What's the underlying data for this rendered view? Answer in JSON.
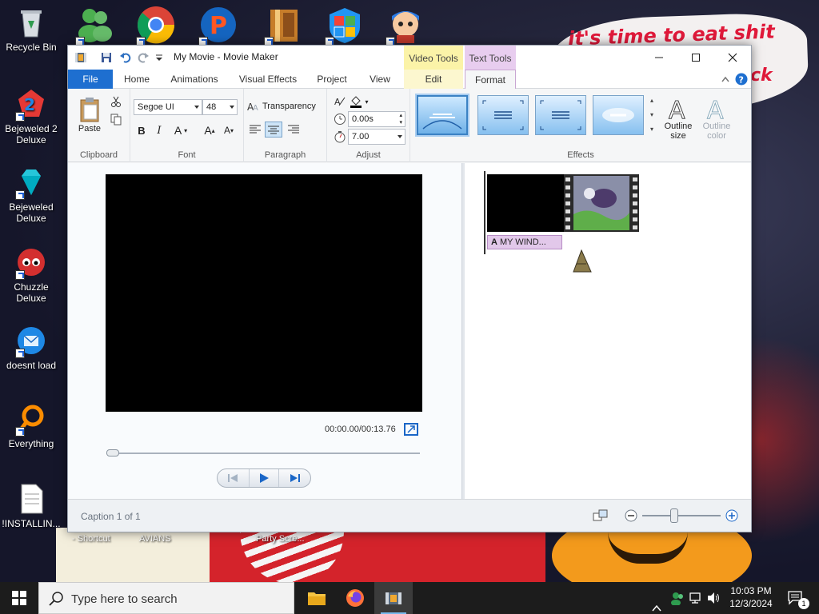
{
  "desktop": {
    "note_text": "it's time to eat shit",
    "note_text2": "ck",
    "icons": [
      {
        "label": "Recycle Bin"
      },
      {
        "label": "Bejeweled 2 Deluxe"
      },
      {
        "label": "Bejeweled Deluxe"
      },
      {
        "label": "Chuzzle Deluxe"
      },
      {
        "label": "doesnt load"
      },
      {
        "label": "Everything"
      },
      {
        "label": "!INSTALLIN..."
      }
    ],
    "bottom_labels": [
      "- Shortcut",
      "AVIANS",
      "Party Scre..."
    ]
  },
  "window": {
    "title": "My Movie - Movie Maker",
    "context_video": "Video Tools",
    "context_text": "Text Tools",
    "tabs": {
      "file": "File",
      "home": "Home",
      "animations": "Animations",
      "visual_effects": "Visual Effects",
      "project": "Project",
      "view": "View",
      "edit": "Edit",
      "format": "Format"
    },
    "ribbon": {
      "clipboard": {
        "label": "Clipboard",
        "paste": "Paste"
      },
      "font": {
        "label": "Font",
        "family": "Segoe UI",
        "size": "48",
        "bold": "B",
        "italic": "I",
        "color": "A",
        "grow": "A",
        "shrink": "A"
      },
      "paragraph": {
        "label": "Paragraph",
        "transparency": "Transparency"
      },
      "adjust": {
        "label": "Adjust",
        "start_time": "0.00s",
        "duration": "7.00"
      },
      "effects": {
        "label": "Effects",
        "outline_size": "Outline size",
        "outline_color": "Outline color"
      }
    },
    "preview": {
      "timecode": "00:00.00/00:13.76",
      "seek_progress": 0.0
    },
    "storyboard": {
      "caption_label": "MY WIND..."
    },
    "status": {
      "caption": "Caption 1 of 1",
      "zoom_level": 0.4
    }
  },
  "taskbar": {
    "search_placeholder": "Type here to search",
    "time": "10:03 PM",
    "date": "12/3/2024",
    "notification_count": "1"
  },
  "colors": {
    "accent": "#1e6fd0",
    "video_tools": "#fbf3a8",
    "text_tools": "#e8cdef",
    "taskbar": "#1c1c1c"
  }
}
